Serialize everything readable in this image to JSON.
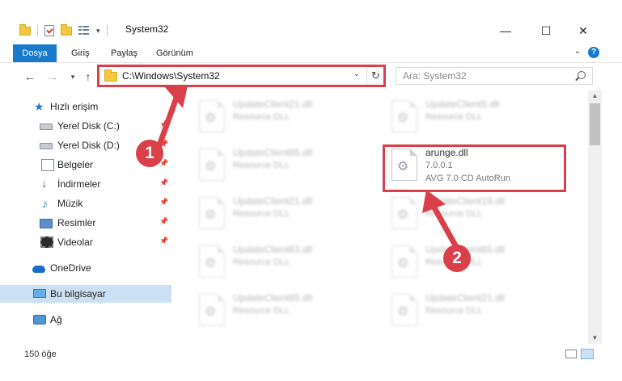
{
  "window": {
    "title": "System32",
    "minimize": "—",
    "maximize": "☐",
    "close": "✕"
  },
  "ribbon": {
    "tabs": [
      "Dosya",
      "Giriş",
      "Paylaş",
      "Görünüm"
    ]
  },
  "address_bar": {
    "path": "C:\\Windows\\System32",
    "search_placeholder": "Ara: System32"
  },
  "sidebar": {
    "items": [
      {
        "label": "Hızlı erişim",
        "icon": "star-icon"
      },
      {
        "label": "Yerel Disk (C:)",
        "icon": "drive-icon",
        "pinned": true
      },
      {
        "label": "Yerel Disk (D:)",
        "icon": "drive-icon",
        "pinned": true
      },
      {
        "label": "Belgeler",
        "icon": "documents-icon",
        "pinned": true
      },
      {
        "label": "İndirmeler",
        "icon": "downloads-icon",
        "pinned": true
      },
      {
        "label": "Müzik",
        "icon": "music-icon",
        "pinned": true
      },
      {
        "label": "Resimler",
        "icon": "pictures-icon",
        "pinned": true
      },
      {
        "label": "Videolar",
        "icon": "videos-icon",
        "pinned": true
      },
      {
        "label": "OneDrive",
        "icon": "cloud-icon"
      },
      {
        "label": "Bu bilgisayar",
        "icon": "computer-icon",
        "selected": true
      },
      {
        "label": "Ağ",
        "icon": "network-icon"
      }
    ]
  },
  "files": [
    {
      "name": "UpdateClient21.dll",
      "type": "Resource DLL"
    },
    {
      "name": "UpdateClient5.dll",
      "type": "Resource DLL"
    },
    {
      "name": "UpdateClient65.dll",
      "type": "Resource DLL"
    },
    {
      "name": "UpdateClient21.dll",
      "type": "Resource DLL"
    },
    {
      "name": "UpdateClient19.dll",
      "type": "Resource DLL"
    },
    {
      "name": "UpdateClient63.dll",
      "type": "Resource DLL"
    },
    {
      "name": "UpdateClient65.dll",
      "type": "Resource DLL"
    },
    {
      "name": "UpdateClient65.dll",
      "type": "Resource DLL"
    },
    {
      "name": "UpdateClient21.dll",
      "type": "Resource DLL"
    }
  ],
  "highlighted_file": {
    "name": "arunge.dll",
    "version": "7.0.0.1",
    "description": "AVG 7.0 CD AutoRun"
  },
  "status": {
    "item_count": "150 öğe"
  },
  "annotations": {
    "step1": "1",
    "step2": "2",
    "color": "#d9404a"
  }
}
